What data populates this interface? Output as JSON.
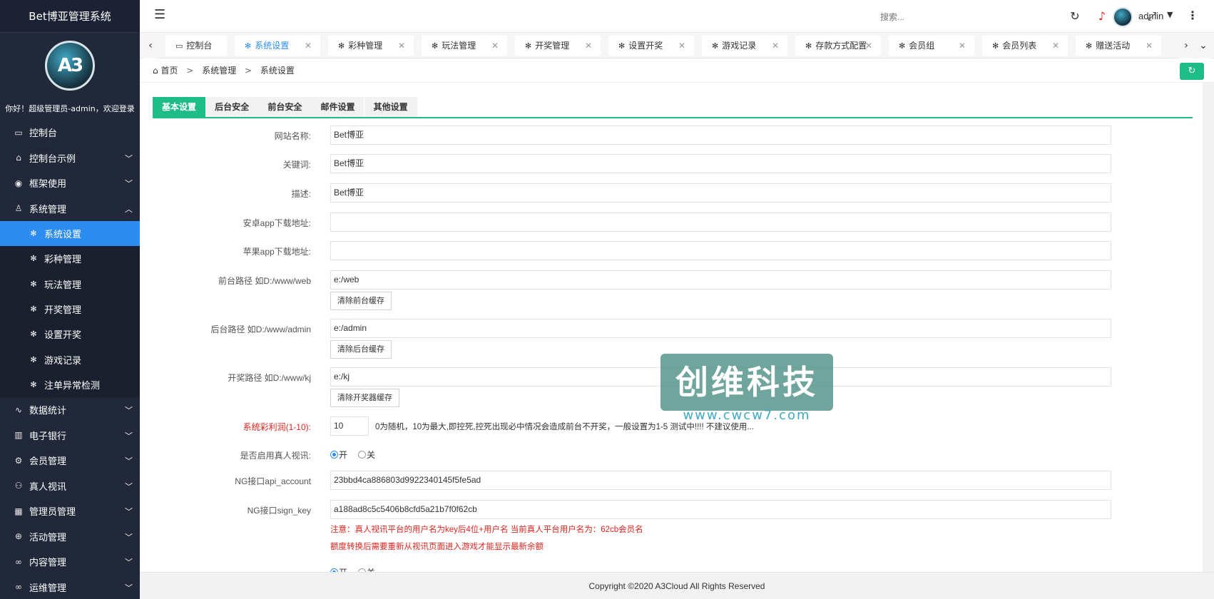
{
  "app": {
    "title": "Bet博亚管理系统",
    "welcome": "你好！超级管理员-admin，欢迎登录",
    "logo_text": "A3"
  },
  "sidebar": {
    "items": [
      {
        "label": "控制台",
        "icon": "monitor-icon"
      },
      {
        "label": "控制台示例",
        "icon": "home-icon"
      },
      {
        "label": "框架使用",
        "icon": "ok-icon"
      },
      {
        "label": "系统管理",
        "icon": "user-icon"
      }
    ],
    "sub_items": [
      {
        "label": "系统设置",
        "active": true
      },
      {
        "label": "彩种管理"
      },
      {
        "label": "玩法管理"
      },
      {
        "label": "开奖管理"
      },
      {
        "label": "设置开奖"
      },
      {
        "label": "游戏记录"
      },
      {
        "label": "注单异常检测"
      }
    ],
    "items_after": [
      {
        "label": "数据统计",
        "icon": "pulse-icon"
      },
      {
        "label": "电子银行",
        "icon": "book-icon"
      },
      {
        "label": "会员管理",
        "icon": "gear-icon"
      },
      {
        "label": "真人视讯",
        "icon": "people-icon"
      },
      {
        "label": "管理员管理",
        "icon": "grid-icon"
      },
      {
        "label": "活动管理",
        "icon": "plus-circle-icon"
      },
      {
        "label": "内容管理",
        "icon": "infinity-icon"
      },
      {
        "label": "运维管理",
        "icon": "infinity-icon"
      }
    ]
  },
  "header": {
    "search_placeholder": "搜索...",
    "username": "admin"
  },
  "tabs": [
    {
      "label": "控制台"
    },
    {
      "label": "系统设置",
      "active": true
    },
    {
      "label": "彩种管理"
    },
    {
      "label": "玩法管理"
    },
    {
      "label": "开奖管理"
    },
    {
      "label": "设置开奖"
    },
    {
      "label": "游戏记录"
    },
    {
      "label": "存款方式配置"
    },
    {
      "label": "会员组"
    },
    {
      "label": "会员列表"
    },
    {
      "label": "赠送活动"
    }
  ],
  "breadcrumb": {
    "home": "首页",
    "level1": "系统管理",
    "level2": "系统设置",
    "sep": ">"
  },
  "subtabs": [
    "基本设置",
    "后台安全",
    "前台安全",
    "邮件设置",
    "其他设置"
  ],
  "form": {
    "site_name_label": "网站名称:",
    "site_name": "Bet博亚",
    "keywords_label": "关键词:",
    "keywords": "Bet博亚",
    "desc_label": "描述:",
    "desc": "Bet博亚",
    "android_label": "安卓app下载地址:",
    "android": "",
    "ios_label": "苹果app下载地址:",
    "ios": "",
    "front_path_label": "前台路径 如D:/www/web",
    "front_path": "e:/web",
    "clear_front": "清除前台缓存",
    "admin_path_label": "后台路径 如D:/www/admin",
    "admin_path": "e:/admin",
    "clear_admin": "清除后台缓存",
    "kj_path_label": "开奖路径 如D:/www/kj",
    "kj_path": "e:/kj",
    "clear_kj": "清除开奖器缓存",
    "profit_label": "系统彩利润(1-10):",
    "profit": "10",
    "profit_note": "0为随机，10为最大,即控死,控死出现必中情况会造成前台不开奖，一般设置为1-5 测试中!!!! 不建议使用...",
    "live_label": "是否启用真人视讯:",
    "on": "开",
    "off": "关",
    "ng_account_label": "NG接口api_account",
    "ng_account": "23bbd4ca886803d9922340145f5fe5ad",
    "ng_key_label": "NG接口sign_key",
    "ng_key": "a188ad8c5c5406b8cfd5a21b7f0f62cb",
    "note1": "注意：真人视讯平台的用户名为key后4位+用户名 当前真人平台用户名为：62cb会员名",
    "note2": "额度转换后需要重新从视讯页面进入游戏才能显示最新余额"
  },
  "watermark": {
    "title": "创维科技",
    "url": "www.cwcw7.com"
  },
  "footer": "Copyright ©2020 A3Cloud All Rights Reserved"
}
